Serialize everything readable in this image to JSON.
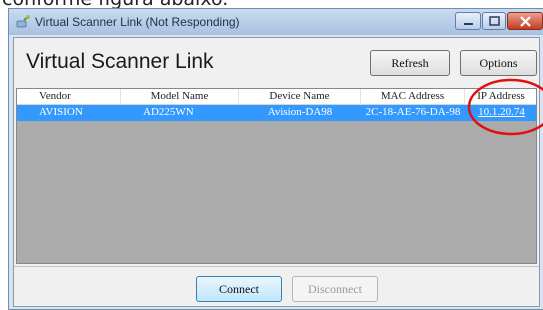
{
  "caption": {
    "text": "conforme figura abaixo."
  },
  "window": {
    "title": "Virtual Scanner Link (Not Responding)",
    "app_title": "Virtual Scanner Link"
  },
  "toolbar": {
    "refresh_label": "Refresh",
    "options_label": "Options"
  },
  "table": {
    "headers": [
      "Vendor",
      "Model Name",
      "Device Name",
      "MAC Address",
      "IP Address"
    ],
    "rows": [
      {
        "vendor": "AVISION",
        "model": "AD225WN",
        "device": "Avision-DA98",
        "mac": "2C-18-AE-76-DA-98",
        "ip": "10.1.20.74",
        "selected": true
      }
    ]
  },
  "footer": {
    "connect_label": "Connect",
    "disconnect_label": "Disconnect"
  },
  "colors": {
    "selection": "#3399ff",
    "annotation": "#e01010",
    "list_background": "#ababab"
  },
  "icons": {
    "app": "scanner-plug-icon",
    "minimize": "minimize-icon",
    "maximize": "maximize-icon",
    "close": "close-icon"
  }
}
